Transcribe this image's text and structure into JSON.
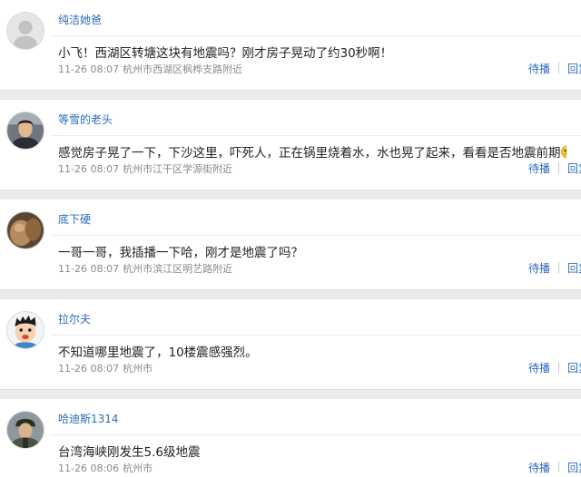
{
  "actions": {
    "retweet_label": "待播",
    "reply_label": "回复"
  },
  "posts": [
    {
      "username": "纯洁她爸",
      "avatar": "default-avatar",
      "content": "小飞！西湖区转塘这块有地震吗？刚才房子晃动了约30秒啊！",
      "time": "11-26 08:07",
      "location": "杭州市西湖区枫桦支路附近"
    },
    {
      "username": "等雪的老头",
      "avatar": "man-photo-avatar",
      "content": "感觉房子晃了一下，下沙这里，吓死人，正在锅里烧着水，水也晃了起来，看看是否地震前期",
      "emoji": "dizzy-face-emoji",
      "time": "11-26 08:07",
      "location": "杭州市江干区学源街附近"
    },
    {
      "username": "底下硬",
      "avatar": "photo-avatar",
      "content": "一哥一哥，我插播一下哈，刚才是地震了吗？",
      "time": "11-26 08:07",
      "location": "杭州市滨江区明艺路附近"
    },
    {
      "username": "拉尔夫",
      "avatar": "cartoon-boy-avatar",
      "content": "不知道哪里地震了，10楼震感强烈。",
      "time": "11-26 08:07",
      "location": "杭州市"
    },
    {
      "username": "哈迪斯1314",
      "avatar": "soldier-avatar",
      "content": "台湾海峡刚发生5.6级地震",
      "time": "11-26 08:06",
      "location": "杭州市"
    }
  ],
  "colors": {
    "link": "#2b6cb8",
    "text": "#222222",
    "meta": "#8a8a8a",
    "background": "#ebebeb"
  }
}
